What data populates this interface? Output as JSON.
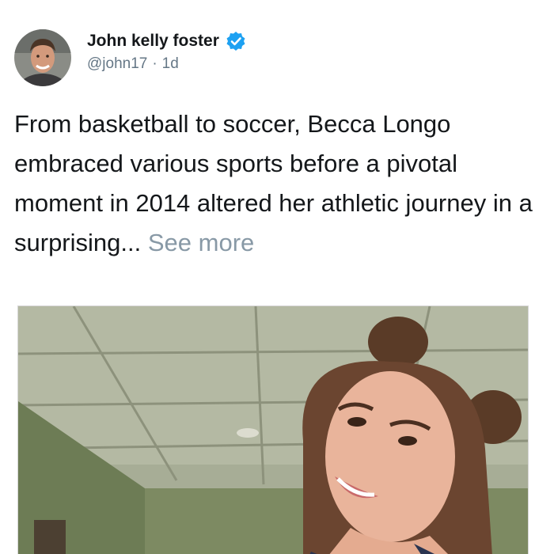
{
  "post": {
    "author": {
      "name": "John kelly foster",
      "handle": "@john17",
      "separator": "·",
      "time": "1d",
      "verified": true,
      "avatar_icon": "profile-photo"
    },
    "text": "From basketball to soccer, Becca Longo embraced various sports before a pivotal moment in 2014 altered her athletic journey in a surprising...",
    "see_more": "See more",
    "media": {
      "icon": "photo-woman-smiling-ceiling"
    }
  },
  "colors": {
    "verified": "#1da1f2",
    "handle": "#657786",
    "see_more": "#8899a6",
    "text": "#14171a"
  }
}
